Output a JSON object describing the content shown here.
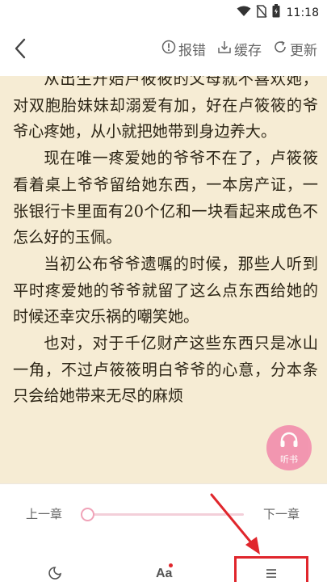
{
  "status_bar": {
    "time": "11:18",
    "icons": [
      "wifi-icon",
      "no-sim-icon",
      "battery-icon"
    ]
  },
  "top_bar": {
    "back_icon": "back-arrow-icon",
    "actions": [
      {
        "icon": "report-icon",
        "label": "报错"
      },
      {
        "icon": "download-icon",
        "label": "缓存"
      },
      {
        "icon": "refresh-icon",
        "label": "更新"
      }
    ]
  },
  "reader": {
    "paragraphs": [
      "从出生开始卢筱筱的父母就不喜欢她，对双胞胎妹妹却溺爱有加，好在卢筱筱的爷爷心疼她，从小就把她带到身边养大。",
      "现在唯一疼爱她的爷爷不在了，卢筱筱看着桌上爷爷留给她东西，一本房产证，一张银行卡里面有20个亿和一块看起来成色不怎么好的玉佩。",
      "当初公布爷爷遗嘱的时候，那些人听到平时疼爱她的爷爷就留了这么点东西给她的时候还幸灾乐祸的嘲笑她。",
      "也对，对于千亿财产这些东西只是冰山一角，不过卢筱筱明白爷爷的心意，分本条只会给她带来无尽的麻烦"
    ]
  },
  "listen_button": {
    "label": "听书",
    "icon": "headphones-icon"
  },
  "chapter_nav": {
    "prev_label": "上一章",
    "next_label": "下一章",
    "progress": 0
  },
  "bottom_toolbar": {
    "items": [
      {
        "icon": "night-mode-icon"
      },
      {
        "icon": "font-settings-icon",
        "label": "Aa"
      },
      {
        "icon": "table-of-contents-icon"
      }
    ]
  },
  "colors": {
    "reader_background": "#f6ecd4",
    "accent_pink": "#f28fae",
    "annotation_red": "#e0262c"
  }
}
